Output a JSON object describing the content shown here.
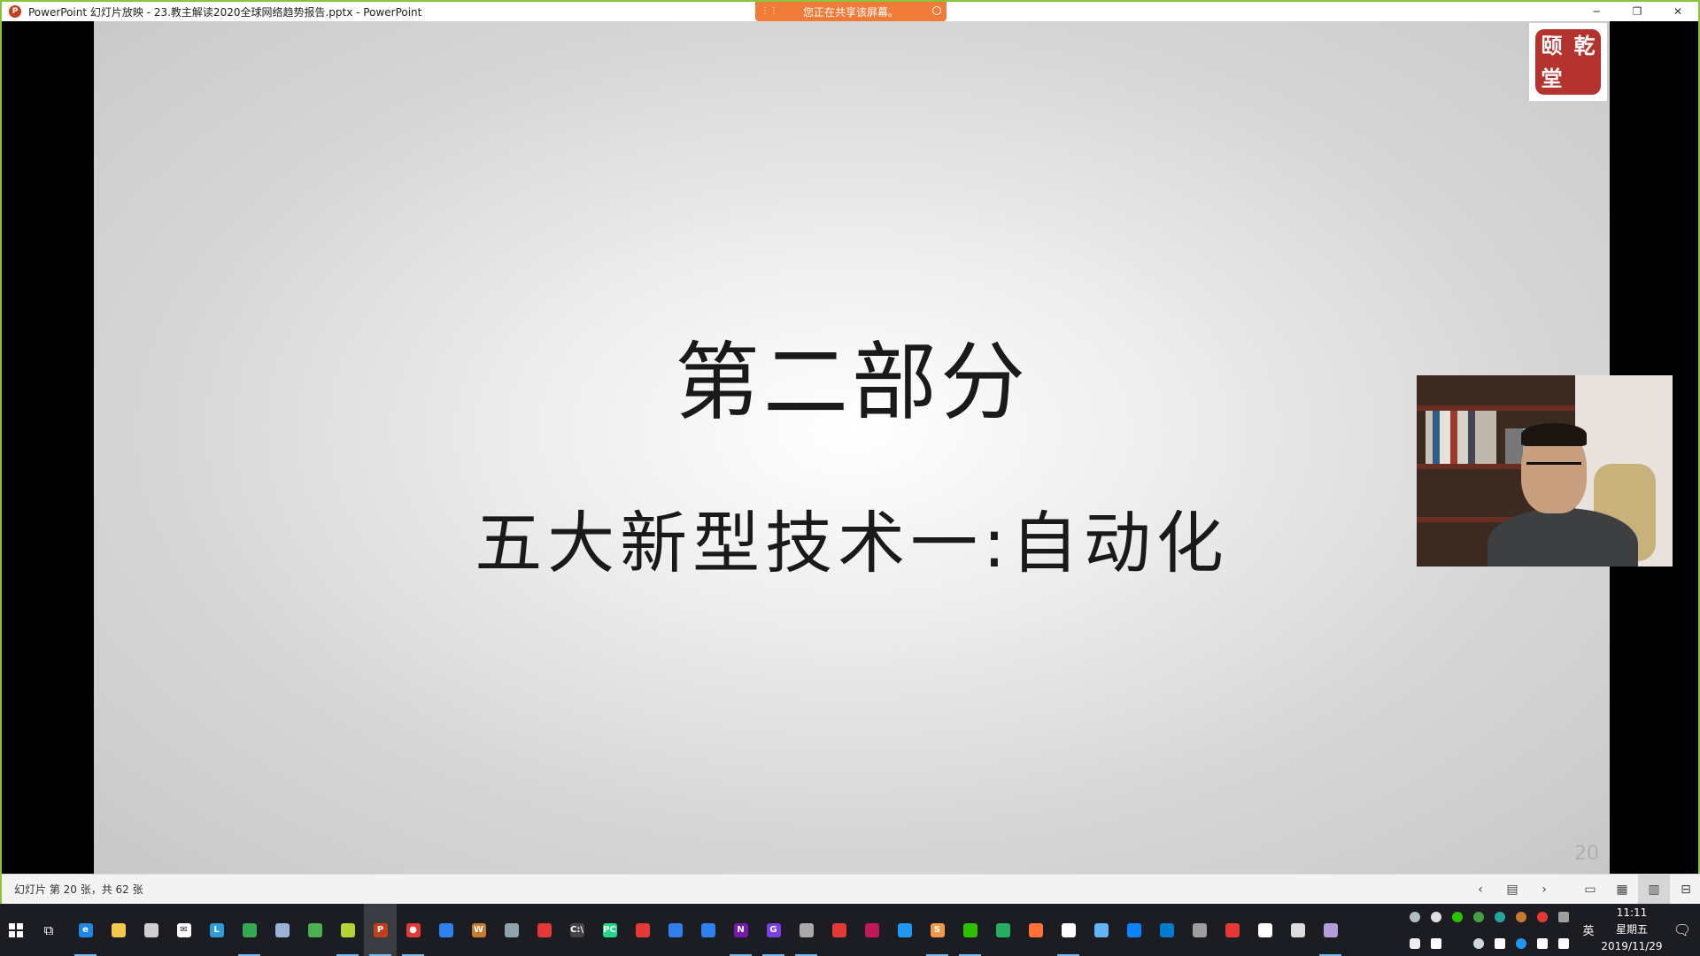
{
  "window": {
    "title": "PowerPoint 幻灯片放映  -  23.教主解读2020全球网络趋势报告.pptx - PowerPoint",
    "app_badge": "P",
    "minimize": "─",
    "restore": "❐",
    "close": "✕"
  },
  "share_banner": {
    "text": "您正在共享该屏幕。",
    "grip": "⋮⋮"
  },
  "slide": {
    "title": "第二部分",
    "subtitle": "五大新型技术一:自动化",
    "number": "20",
    "logo_chars": [
      "颐",
      "乾",
      "堂",
      ""
    ]
  },
  "statusbar": {
    "slide_info": "幻灯片 第 20 张，共 62 张",
    "prev": "‹",
    "menu": "▤",
    "next": "›",
    "view_normal": "▭",
    "view_sorter": "▦",
    "view_reading": "▥",
    "view_slideshow": "⊟"
  },
  "taskbar": {
    "taskview": "⧉",
    "apps": [
      {
        "name": "edge",
        "label": "e",
        "color": "#1e88e5"
      },
      {
        "name": "file-explorer",
        "label": "",
        "color": "#f2c94c"
      },
      {
        "name": "store",
        "label": "",
        "color": "#cfcfcf"
      },
      {
        "name": "mail",
        "label": "✉",
        "color": "#ffffff"
      },
      {
        "name": "app-l",
        "label": "L",
        "color": "#2d9cdb"
      },
      {
        "name": "chrome",
        "label": "",
        "color": "#34a853"
      },
      {
        "name": "app-6",
        "label": "",
        "color": "#9bb3d6"
      },
      {
        "name": "app-7",
        "label": "",
        "color": "#4caf50"
      },
      {
        "name": "app-8",
        "label": "",
        "color": "#b5d334"
      },
      {
        "name": "powerpoint",
        "label": "P",
        "color": "#c43e1c"
      },
      {
        "name": "app-record",
        "label": "●",
        "color": "#e53935"
      },
      {
        "name": "app-11",
        "label": "",
        "color": "#2f80ed"
      },
      {
        "name": "app-12",
        "label": "W",
        "color": "#c77b30"
      },
      {
        "name": "app-13",
        "label": "",
        "color": "#90a4ae"
      },
      {
        "name": "app-14",
        "label": "",
        "color": "#e53935"
      },
      {
        "name": "terminal",
        "label": "C:\\",
        "color": "#444444"
      },
      {
        "name": "pycharm",
        "label": "PC",
        "color": "#21d789"
      },
      {
        "name": "app-17",
        "label": "",
        "color": "#e53935"
      },
      {
        "name": "app-18",
        "label": "",
        "color": "#2f80ed"
      },
      {
        "name": "app-19",
        "label": "",
        "color": "#2f80ed"
      },
      {
        "name": "onenote",
        "label": "N",
        "color": "#7719aa"
      },
      {
        "name": "app-21",
        "label": "G",
        "color": "#7b3fe4"
      },
      {
        "name": "app-22",
        "label": "",
        "color": "#aaaaaa"
      },
      {
        "name": "app-23",
        "label": "",
        "color": "#e53935"
      },
      {
        "name": "app-24",
        "label": "",
        "color": "#c2185b"
      },
      {
        "name": "app-25",
        "label": "",
        "color": "#2196f3"
      },
      {
        "name": "sublime",
        "label": "S",
        "color": "#f2994a"
      },
      {
        "name": "wechat",
        "label": "",
        "color": "#2dc100"
      },
      {
        "name": "app-28",
        "label": "",
        "color": "#27ae60"
      },
      {
        "name": "firefox",
        "label": "",
        "color": "#ff7139"
      },
      {
        "name": "app-30",
        "label": "",
        "color": "#ffffff"
      },
      {
        "name": "app-31",
        "label": "",
        "color": "#64b5f6"
      },
      {
        "name": "onedrive",
        "label": "",
        "color": "#0a84ff"
      },
      {
        "name": "vscode",
        "label": "",
        "color": "#007acc"
      },
      {
        "name": "app-34",
        "label": "",
        "color": "#9e9e9e"
      },
      {
        "name": "app-35",
        "label": "",
        "color": "#e53935"
      },
      {
        "name": "app-36",
        "label": "",
        "color": "#ffffff"
      },
      {
        "name": "calculator",
        "label": "",
        "color": "#dddddd"
      },
      {
        "name": "app-38",
        "label": "",
        "color": "#b39ddb"
      }
    ],
    "tray": {
      "ime": "英",
      "time": "11:11",
      "weekday": "星期五",
      "date": "2019/11/29",
      "notification": "🗨"
    }
  }
}
